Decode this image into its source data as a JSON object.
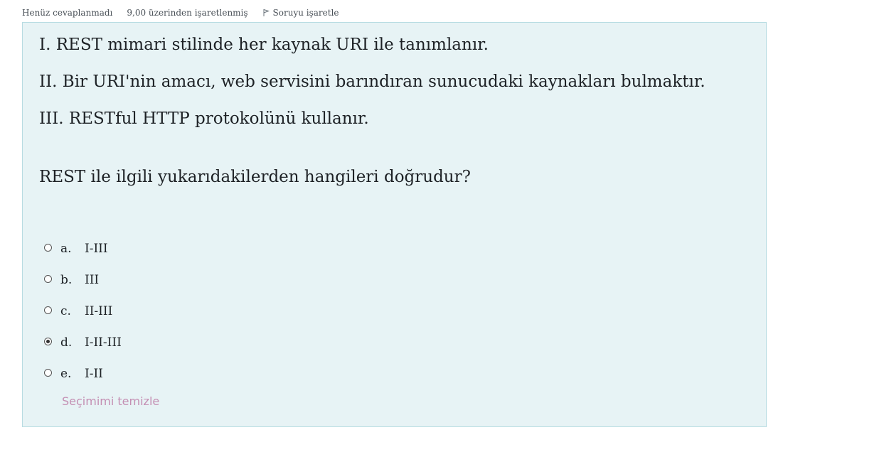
{
  "info": {
    "state": "Henüz cevaplanmadı",
    "grade": "9,00 üzerinden işaretlenmiş",
    "flag_label": "Soruyu işaretle",
    "flag_icon": "flag-icon"
  },
  "question": {
    "statements": [
      "I. REST mimari stilinde her kaynak URI ile tanımlanır.",
      "II. Bir URI'nin amacı, web servisini barındıran sunucudaki kaynakları bulmaktır.",
      "III. RESTful HTTP protokolünü kullanır."
    ],
    "prompt": "REST ile ilgili yukarıdakilerden hangileri doğrudur?"
  },
  "answers": [
    {
      "letter": "a.",
      "text": "I-III",
      "selected": false
    },
    {
      "letter": "b.",
      "text": "III",
      "selected": false
    },
    {
      "letter": "c.",
      "text": "II-III",
      "selected": false
    },
    {
      "letter": "d.",
      "text": "I-II-III",
      "selected": true
    },
    {
      "letter": "e.",
      "text": "I-II",
      "selected": false
    }
  ],
  "clear_choice": "Seçimimi temizle",
  "colors": {
    "panel_bg": "#e7f3f5",
    "panel_border": "#b8dce2",
    "clear_link": "#c48fb3"
  }
}
